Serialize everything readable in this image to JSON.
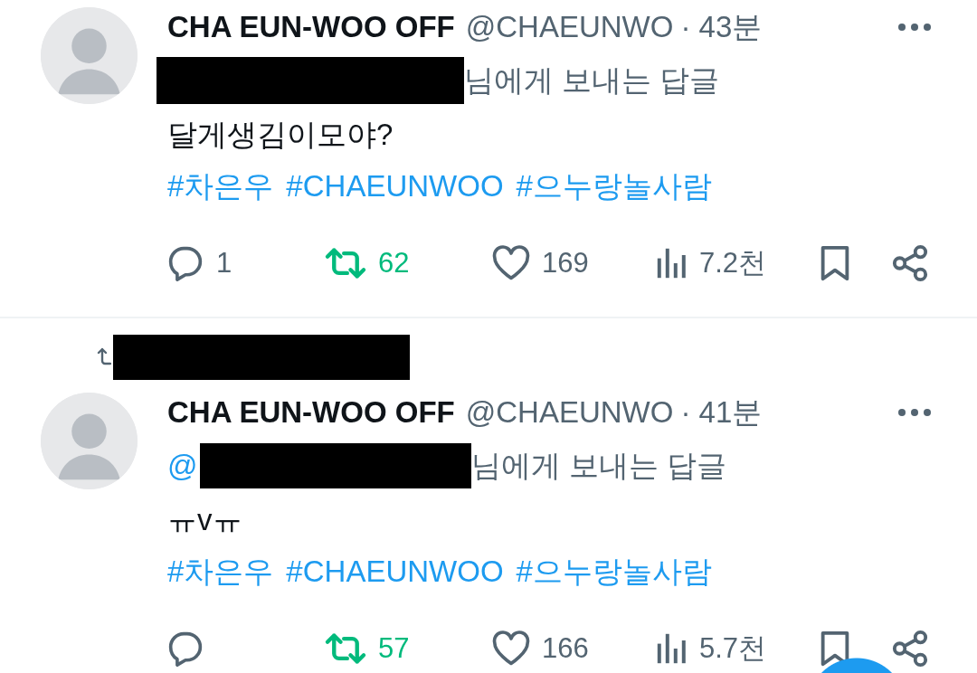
{
  "tweets": [
    {
      "name": "CHA EUN-WOO OFF",
      "handle": "@CHAEUNWO",
      "time": "· 43분",
      "reply_to": {
        "suffix": "님에게 보내는 답글"
      },
      "body": "달게생김이모야?",
      "hashtags": [
        "#차은우",
        "#CHAEUNWOO",
        "#으누랑놀사람"
      ],
      "actions": [
        {
          "kind": "reply",
          "count": "1"
        },
        {
          "kind": "retweet",
          "count": "62",
          "on": true
        },
        {
          "kind": "like",
          "count": "169",
          "on": false
        },
        {
          "kind": "views",
          "count": "7.2천"
        },
        {
          "kind": "bookmark"
        },
        {
          "kind": "share"
        }
      ]
    },
    {
      "social_context": {
        "kind": "retweet"
      },
      "name": "CHA EUN-WOO OFF",
      "handle": "@CHAEUNWO",
      "time": "· 41분",
      "reply_to": {
        "prefix": "@",
        "suffix": "님에게 보내는 답글"
      },
      "body": "ㅠvㅠ",
      "hashtags": [
        "#차은우",
        "#CHAEUNWOO",
        "#으누랑놀사람"
      ],
      "actions": [
        {
          "kind": "reply"
        },
        {
          "kind": "retweet",
          "count": "57",
          "on": true
        },
        {
          "kind": "like",
          "count": "166",
          "on": false
        },
        {
          "kind": "views",
          "count": "5.7천"
        },
        {
          "kind": "bookmark"
        },
        {
          "kind": "share"
        }
      ]
    }
  ],
  "compose_button": {
    "kind": "fab"
  }
}
